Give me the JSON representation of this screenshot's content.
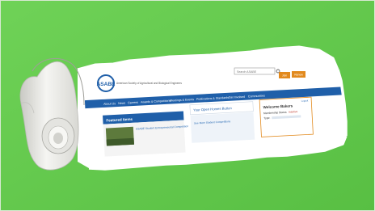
{
  "colors": {
    "background": "#62c84b",
    "background_dark": "#4fb13a",
    "paper": "#f3f3f1",
    "nav_blue": "#1f5fa9",
    "accent_orange": "#e28a1e",
    "link_blue": "#2b6cb5"
  },
  "site": {
    "logo_text": "ASABE",
    "tagline": "American Society of Agricultural and Biological Engineers",
    "search_placeholder": "Search ASABE",
    "header_btn_1": "Join",
    "header_btn_2": "Renew"
  },
  "nav": [
    {
      "label": "About Us"
    },
    {
      "label": "News"
    },
    {
      "label": "Careers"
    },
    {
      "label": "Awards & Competitions"
    },
    {
      "label": "Meetings & Events"
    },
    {
      "label": "Publications & Standards"
    },
    {
      "label": "Get Involved"
    },
    {
      "label": "Communities"
    }
  ],
  "featured": {
    "title": "Featured Items",
    "item_title": "ASABE Student Entrepreneurial Competition"
  },
  "home_page": {
    "title": "Your Open Homes Button",
    "link": "See More Student Competitions"
  },
  "welcome": {
    "title": "Welcome Bakers",
    "membership_label": "Membership Status:",
    "membership_value": "Inactive",
    "type_label": "Type:",
    "login_link": "Logout"
  },
  "icons": {
    "curl": "torn-paper-curl-icon",
    "search": "search-icon"
  }
}
